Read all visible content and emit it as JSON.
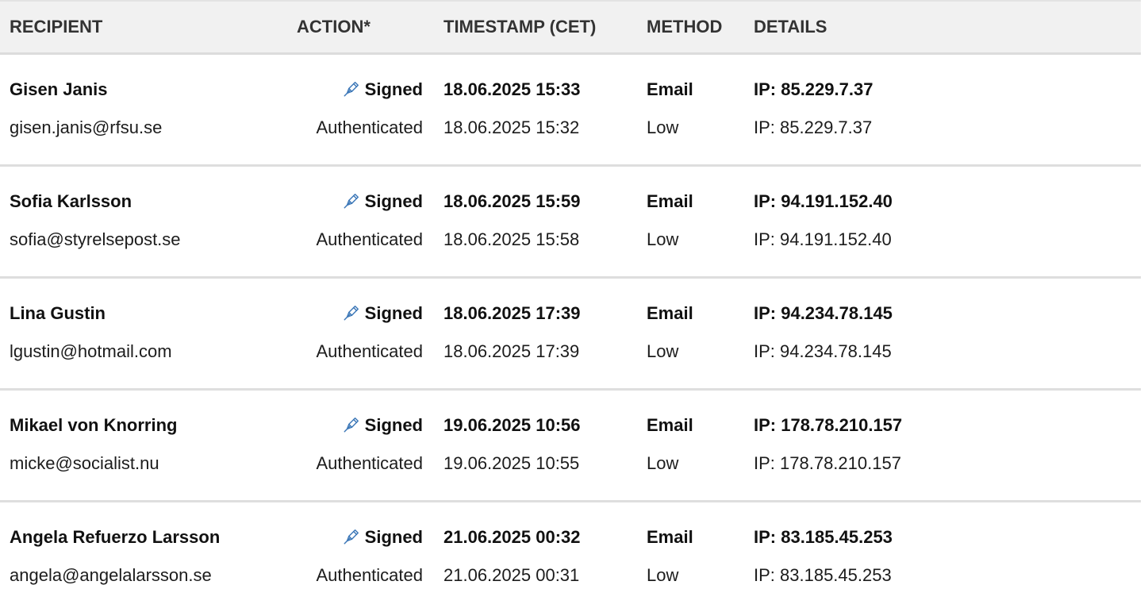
{
  "table": {
    "headers": {
      "recipient": "RECIPIENT",
      "action": "ACTION*",
      "timestamp": "TIMESTAMP (CET)",
      "method": "METHOD",
      "details": "DETAILS"
    },
    "icons": {
      "signed": "pen-icon"
    },
    "rows": [
      {
        "name": "Gisen Janis",
        "email": "gisen.janis@rfsu.se",
        "signed_label": "Signed",
        "signed_time": "18.06.2025 15:33",
        "signed_method": "Email",
        "signed_details": "IP: 85.229.7.37",
        "auth_label": "Authenticated",
        "auth_time": "18.06.2025 15:32",
        "auth_method": "Low",
        "auth_details": "IP: 85.229.7.37"
      },
      {
        "name": "Sofia Karlsson",
        "email": "sofia@styrelsepost.se",
        "signed_label": "Signed",
        "signed_time": "18.06.2025 15:59",
        "signed_method": "Email",
        "signed_details": "IP: 94.191.152.40",
        "auth_label": "Authenticated",
        "auth_time": "18.06.2025 15:58",
        "auth_method": "Low",
        "auth_details": "IP: 94.191.152.40"
      },
      {
        "name": "Lina Gustin",
        "email": "lgustin@hotmail.com",
        "signed_label": "Signed",
        "signed_time": "18.06.2025 17:39",
        "signed_method": "Email",
        "signed_details": "IP: 94.234.78.145",
        "auth_label": "Authenticated",
        "auth_time": "18.06.2025 17:39",
        "auth_method": "Low",
        "auth_details": "IP: 94.234.78.145"
      },
      {
        "name": "Mikael von Knorring",
        "email": "micke@socialist.nu",
        "signed_label": "Signed",
        "signed_time": "19.06.2025 10:56",
        "signed_method": "Email",
        "signed_details": "IP: 178.78.210.157",
        "auth_label": "Authenticated",
        "auth_time": "19.06.2025 10:55",
        "auth_method": "Low",
        "auth_details": "IP: 178.78.210.157"
      },
      {
        "name": "Angela Refuerzo Larsson",
        "email": "angela@angelalarsson.se",
        "signed_label": "Signed",
        "signed_time": "21.06.2025 00:32",
        "signed_method": "Email",
        "signed_details": "IP: 83.185.45.253",
        "auth_label": "Authenticated",
        "auth_time": "21.06.2025 00:31",
        "auth_method": "Low",
        "auth_details": "IP: 83.185.45.253"
      }
    ]
  }
}
